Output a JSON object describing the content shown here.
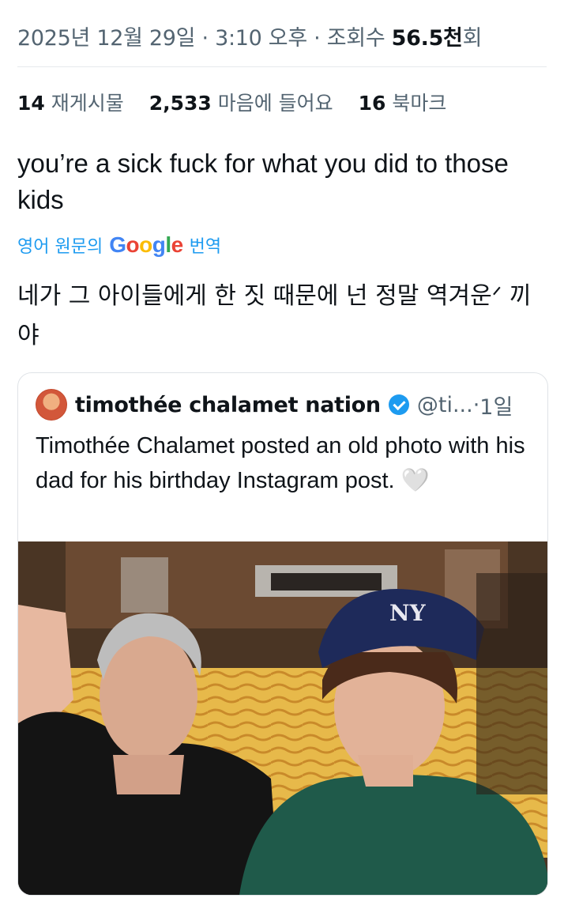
{
  "post_meta": {
    "date": "2025년 12월 29일",
    "sep1": " · ",
    "time": "3:10 오후",
    "sep2": " · ",
    "views_label": "조회수 ",
    "views_value": "56.5천",
    "views_suffix": "회"
  },
  "stats": {
    "reposts_count": "14",
    "reposts_label": " 재게시물",
    "likes_count": "2,533",
    "likes_label": " 마음에 들어요",
    "bookmarks_count": "16",
    "bookmarks_label": " 북마크"
  },
  "tweet": {
    "text": "you’re a sick fuck for what you did to those kids",
    "translate_prefix": "영어 원문의",
    "translate_brand": "Google",
    "translate_suffix": "번역",
    "translated_text": "네가 그 아이들에게 한 짓 때문에 넌 정말 역겨운ᐟ 끼야"
  },
  "quoted_post": {
    "author_name": "timothée chalamet nation",
    "handle": "@ti...",
    "time_sep": " · ",
    "age": "1일",
    "text": "Timothée Chalamet posted an old photo with his dad for his birthday Instagram post.",
    "emoji": "🤍",
    "avatar_icon": "profile-avatar",
    "verified_icon": "verified-badge-icon",
    "photo_description_icon": "photo"
  },
  "colors": {
    "text_primary": "#0f1419",
    "text_secondary": "#536471",
    "link_blue": "#1d9bf0",
    "border": "#dfe3e7"
  }
}
